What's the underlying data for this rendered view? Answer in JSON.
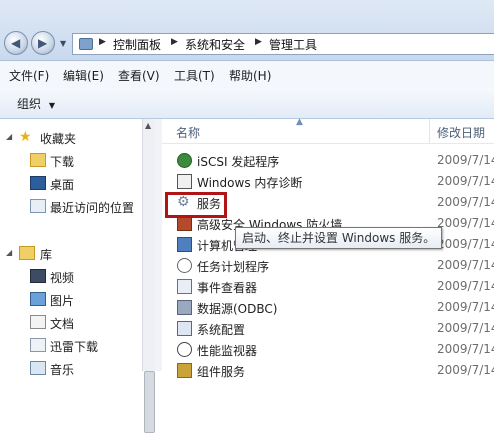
{
  "address_bar": {
    "breadcrumbs": [
      "控制面板",
      "系统和安全",
      "管理工具"
    ]
  },
  "menu": {
    "items": [
      "文件(F)",
      "编辑(E)",
      "查看(V)",
      "工具(T)",
      "帮助(H)"
    ]
  },
  "toolbar": {
    "organize_label": "组织"
  },
  "nav_pane": {
    "favorites_label": "收藏夹",
    "favorites": [
      "下载",
      "桌面",
      "最近访问的位置"
    ],
    "libraries_label": "库",
    "libraries": [
      "视频",
      "图片",
      "文档",
      "迅雷下载",
      "音乐"
    ]
  },
  "columns": {
    "name": "名称",
    "date": "修改日期"
  },
  "files": [
    {
      "name": "iSCSI 发起程序",
      "date": "2009/7/14",
      "icon": "iscsi-icon"
    },
    {
      "name": "Windows 内存诊断",
      "date": "2009/7/14",
      "icon": "memory-diagnostic-icon"
    },
    {
      "name": "服务",
      "date": "2009/7/14",
      "icon": "services-gear-icon"
    },
    {
      "name": "高级安全 Windows 防火墙",
      "date": "2009/7/14",
      "icon": "firewall-icon"
    },
    {
      "name": "计算机管理",
      "date": "2009/7/14",
      "icon": "computer-management-icon"
    },
    {
      "name": "任务计划程序",
      "date": "2009/7/14",
      "icon": "task-scheduler-icon"
    },
    {
      "name": "事件查看器",
      "date": "2009/7/14",
      "icon": "event-viewer-icon"
    },
    {
      "name": "数据源(ODBC)",
      "date": "2009/7/14",
      "icon": "odbc-icon"
    },
    {
      "name": "系统配置",
      "date": "2009/7/14",
      "icon": "system-config-icon"
    },
    {
      "name": "性能监视器",
      "date": "2009/7/14",
      "icon": "performance-monitor-icon"
    },
    {
      "name": "组件服务",
      "date": "2009/7/14",
      "icon": "component-services-icon"
    }
  ],
  "tooltip_text": "启动、终止并设置 Windows 服务。",
  "colors": {
    "highlight_border": "#b01414",
    "accent": "#6f8fb6"
  }
}
